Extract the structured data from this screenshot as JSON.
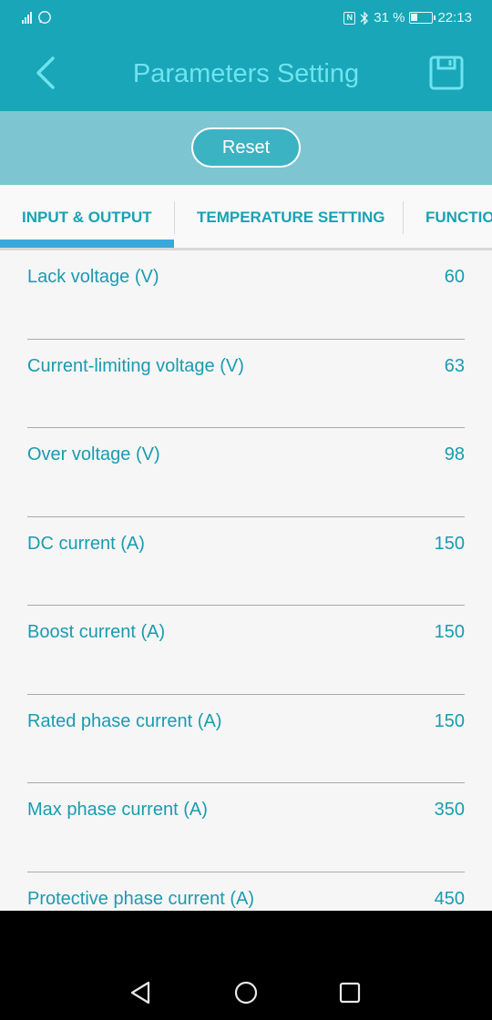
{
  "status_bar": {
    "battery_percent": "31 %",
    "battery_level": 0.31,
    "time": "22:13",
    "icons": [
      "signal-icon",
      "whatsapp-icon",
      "nfc-icon",
      "bluetooth-icon",
      "battery-icon"
    ]
  },
  "header": {
    "title": "Parameters Setting",
    "back_icon": "back-chevron-icon",
    "save_icon": "save-floppy-icon"
  },
  "reset_label": "Reset",
  "tabs": [
    {
      "label": "INPUT & OUTPUT",
      "selected": true
    },
    {
      "label": "TEMPERATURE SETTING",
      "selected": false
    },
    {
      "label": "FUNCTIO",
      "selected": false
    }
  ],
  "parameters": [
    {
      "label": "Lack voltage (V)",
      "value": "60"
    },
    {
      "label": "Current-limiting voltage (V)",
      "value": "63"
    },
    {
      "label": "Over voltage (V)",
      "value": "98"
    },
    {
      "label": "DC current (A)",
      "value": "150"
    },
    {
      "label": "Boost current (A)",
      "value": "150"
    },
    {
      "label": "Rated phase current (A)",
      "value": "150"
    },
    {
      "label": "Max phase current (A)",
      "value": "350"
    },
    {
      "label": "Protective phase current (A)",
      "value": "450"
    }
  ],
  "nav": {
    "back_icon": "nav-back-triangle-icon",
    "home_icon": "nav-home-circle-icon",
    "recents_icon": "nav-recents-square-icon"
  },
  "colors": {
    "header_bg": "#18a6b8",
    "reset_band_bg": "#7dc6d1",
    "accent_text": "#1a9bb0",
    "tab_indicator": "#37a9dd"
  }
}
